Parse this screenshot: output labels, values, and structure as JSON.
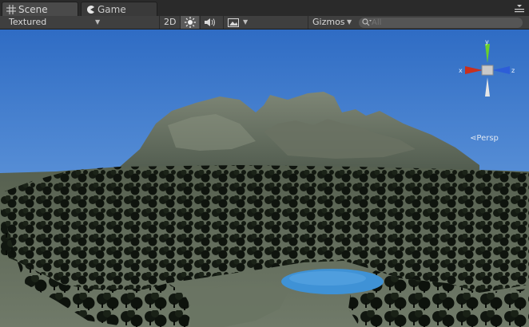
{
  "tabs": [
    {
      "label": "Scene",
      "icon": "grid-icon"
    },
    {
      "label": "Game",
      "icon": "pacman-icon"
    }
  ],
  "toolbar": {
    "draw_mode": "Textured",
    "mode_2d": "2D",
    "lighting_icon": "sun-icon",
    "audio_icon": "speaker-icon",
    "effects_icon": "image-icon",
    "gizmos_label": "Gizmos",
    "search_placeholder": "All"
  },
  "gizmo": {
    "axis_x": "x",
    "axis_y": "y",
    "axis_z": "z",
    "projection": "Persp"
  },
  "colors": {
    "sky_top": "#2f6fc8",
    "sky_bottom": "#8fb6e6",
    "x_axis": "#c8301e",
    "y_axis": "#6ad12a",
    "z_axis": "#2d5ed8",
    "water": "#3f92d6"
  }
}
